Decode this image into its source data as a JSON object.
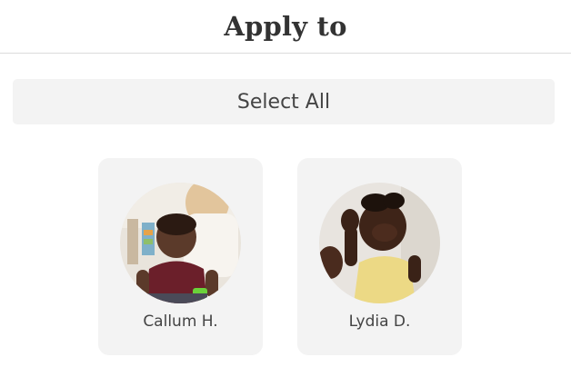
{
  "header": {
    "title": "Apply to"
  },
  "select_all": {
    "label": "Select All"
  },
  "children": [
    {
      "name": "Callum H.",
      "photo": "child-photo"
    },
    {
      "name": "Lydia D.",
      "photo": "child-photo"
    }
  ],
  "colors": {
    "card_bg": "#f3f3f3",
    "text": "#444444",
    "title": "#333333",
    "divider": "#dcdcdc"
  }
}
